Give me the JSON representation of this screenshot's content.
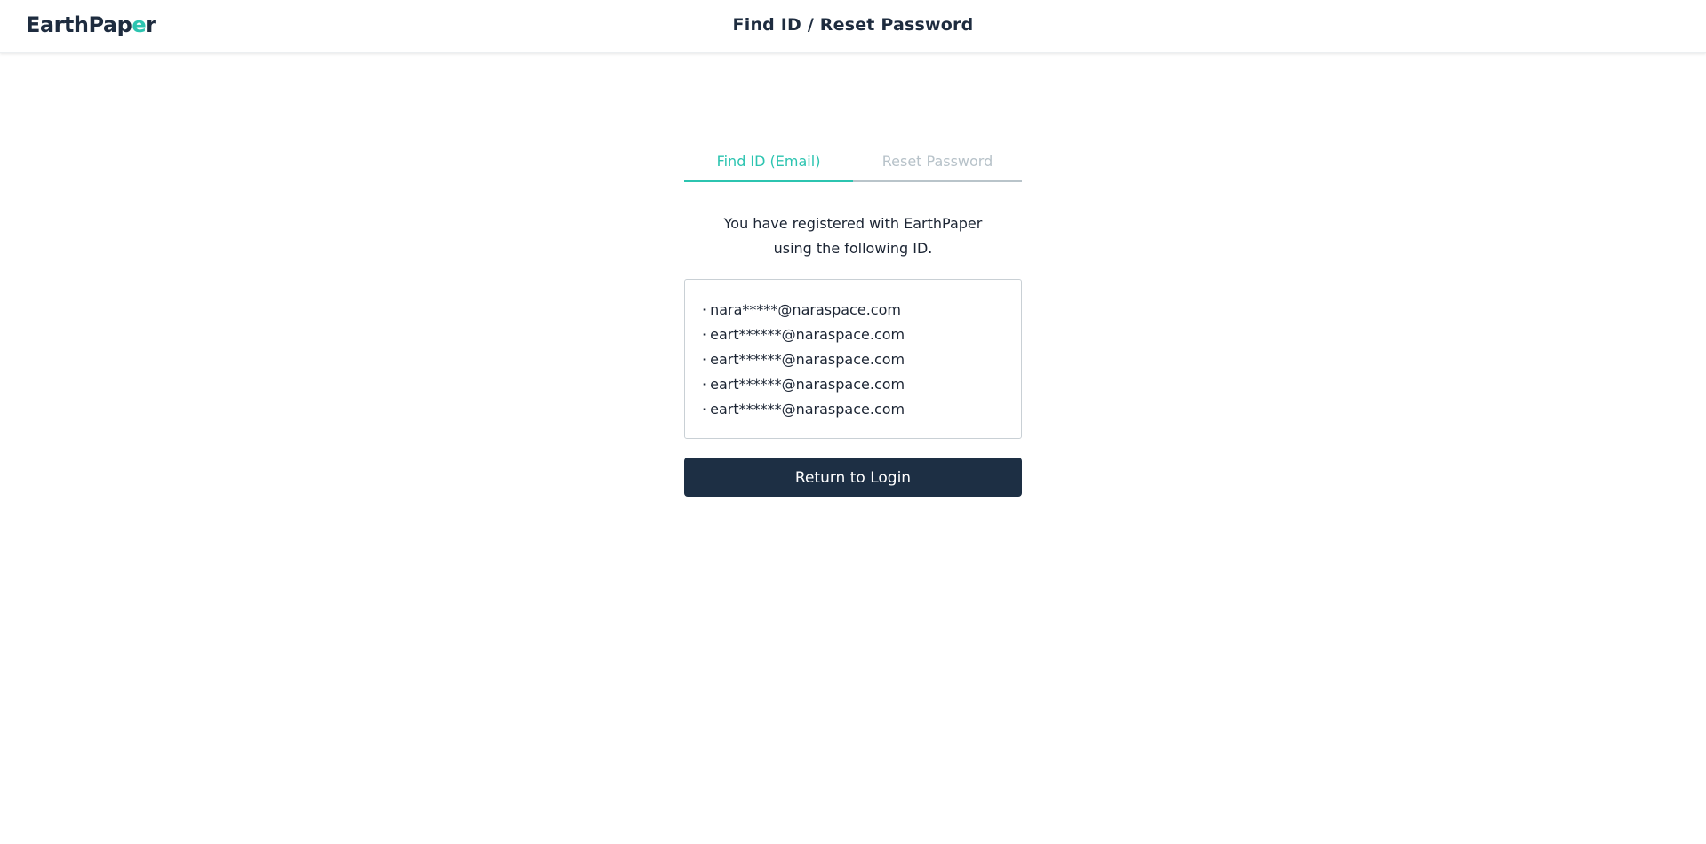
{
  "header": {
    "logo_main": "EarthPap",
    "logo_accent": "e",
    "logo_end": "r",
    "title": "Find ID / Reset Password"
  },
  "tabs": [
    {
      "label": "Find ID (Email)",
      "active": true
    },
    {
      "label": "Reset Password",
      "active": false
    }
  ],
  "message": {
    "line1": "You have registered with EarthPaper",
    "line2": "using the following ID."
  },
  "ids": [
    "nara*****@naraspace.com",
    "eart******@naraspace.com",
    "eart******@naraspace.com",
    "eart******@naraspace.com",
    "eart******@naraspace.com"
  ],
  "bullet": "·",
  "return_button": {
    "label": "Return to Login"
  },
  "colors": {
    "accent": "#2cc4b0",
    "primary_dark": "#1d2f44",
    "inactive_tab": "#b7c2c9"
  }
}
